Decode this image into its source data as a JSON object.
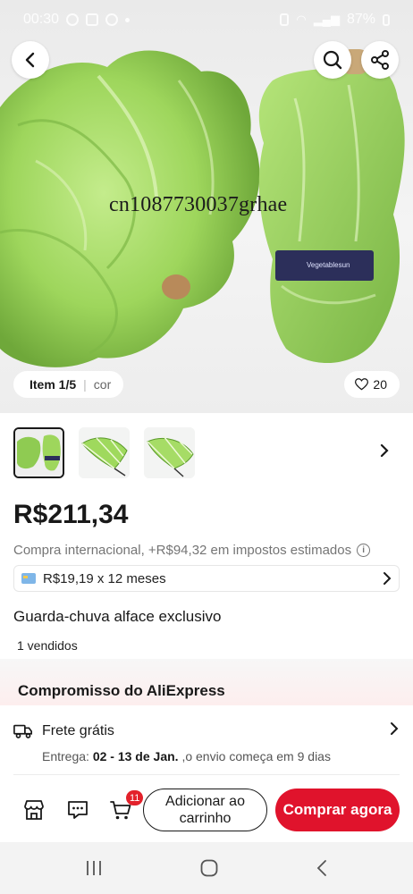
{
  "status_bar": {
    "time": "00:30",
    "battery": "87%"
  },
  "hero": {
    "watermark": "cn1087730037grhae",
    "band_text": "Vegetablesun",
    "image_counter": "Item 1/5",
    "color_label": "cor",
    "likes": "20"
  },
  "colors": {
    "accent": "#e0132c",
    "lettuce": "#9ed65c",
    "badge": "#e3212b"
  },
  "product": {
    "price": "R$211,34",
    "tax_note": "Compra internacional, +R$94,32 em impostos estimados",
    "installments": "R$19,19 x 12 meses",
    "title": "Guarda-chuva alface exclusivo",
    "sold": "1 vendidos"
  },
  "commitment": {
    "title": "Compromisso do AliExpress"
  },
  "shipping": {
    "title": "Frete grátis",
    "delivery_prefix": "Entrega:",
    "delivery_dates": "02 - 13 de Jan.",
    "delivery_suffix": ",o envio começa em 9 dias"
  },
  "action_bar": {
    "cart_count": "11",
    "add_to_cart_line1": "Adicionar ao",
    "add_to_cart_line2": "carrinho",
    "buy_now": "Comprar agora"
  }
}
